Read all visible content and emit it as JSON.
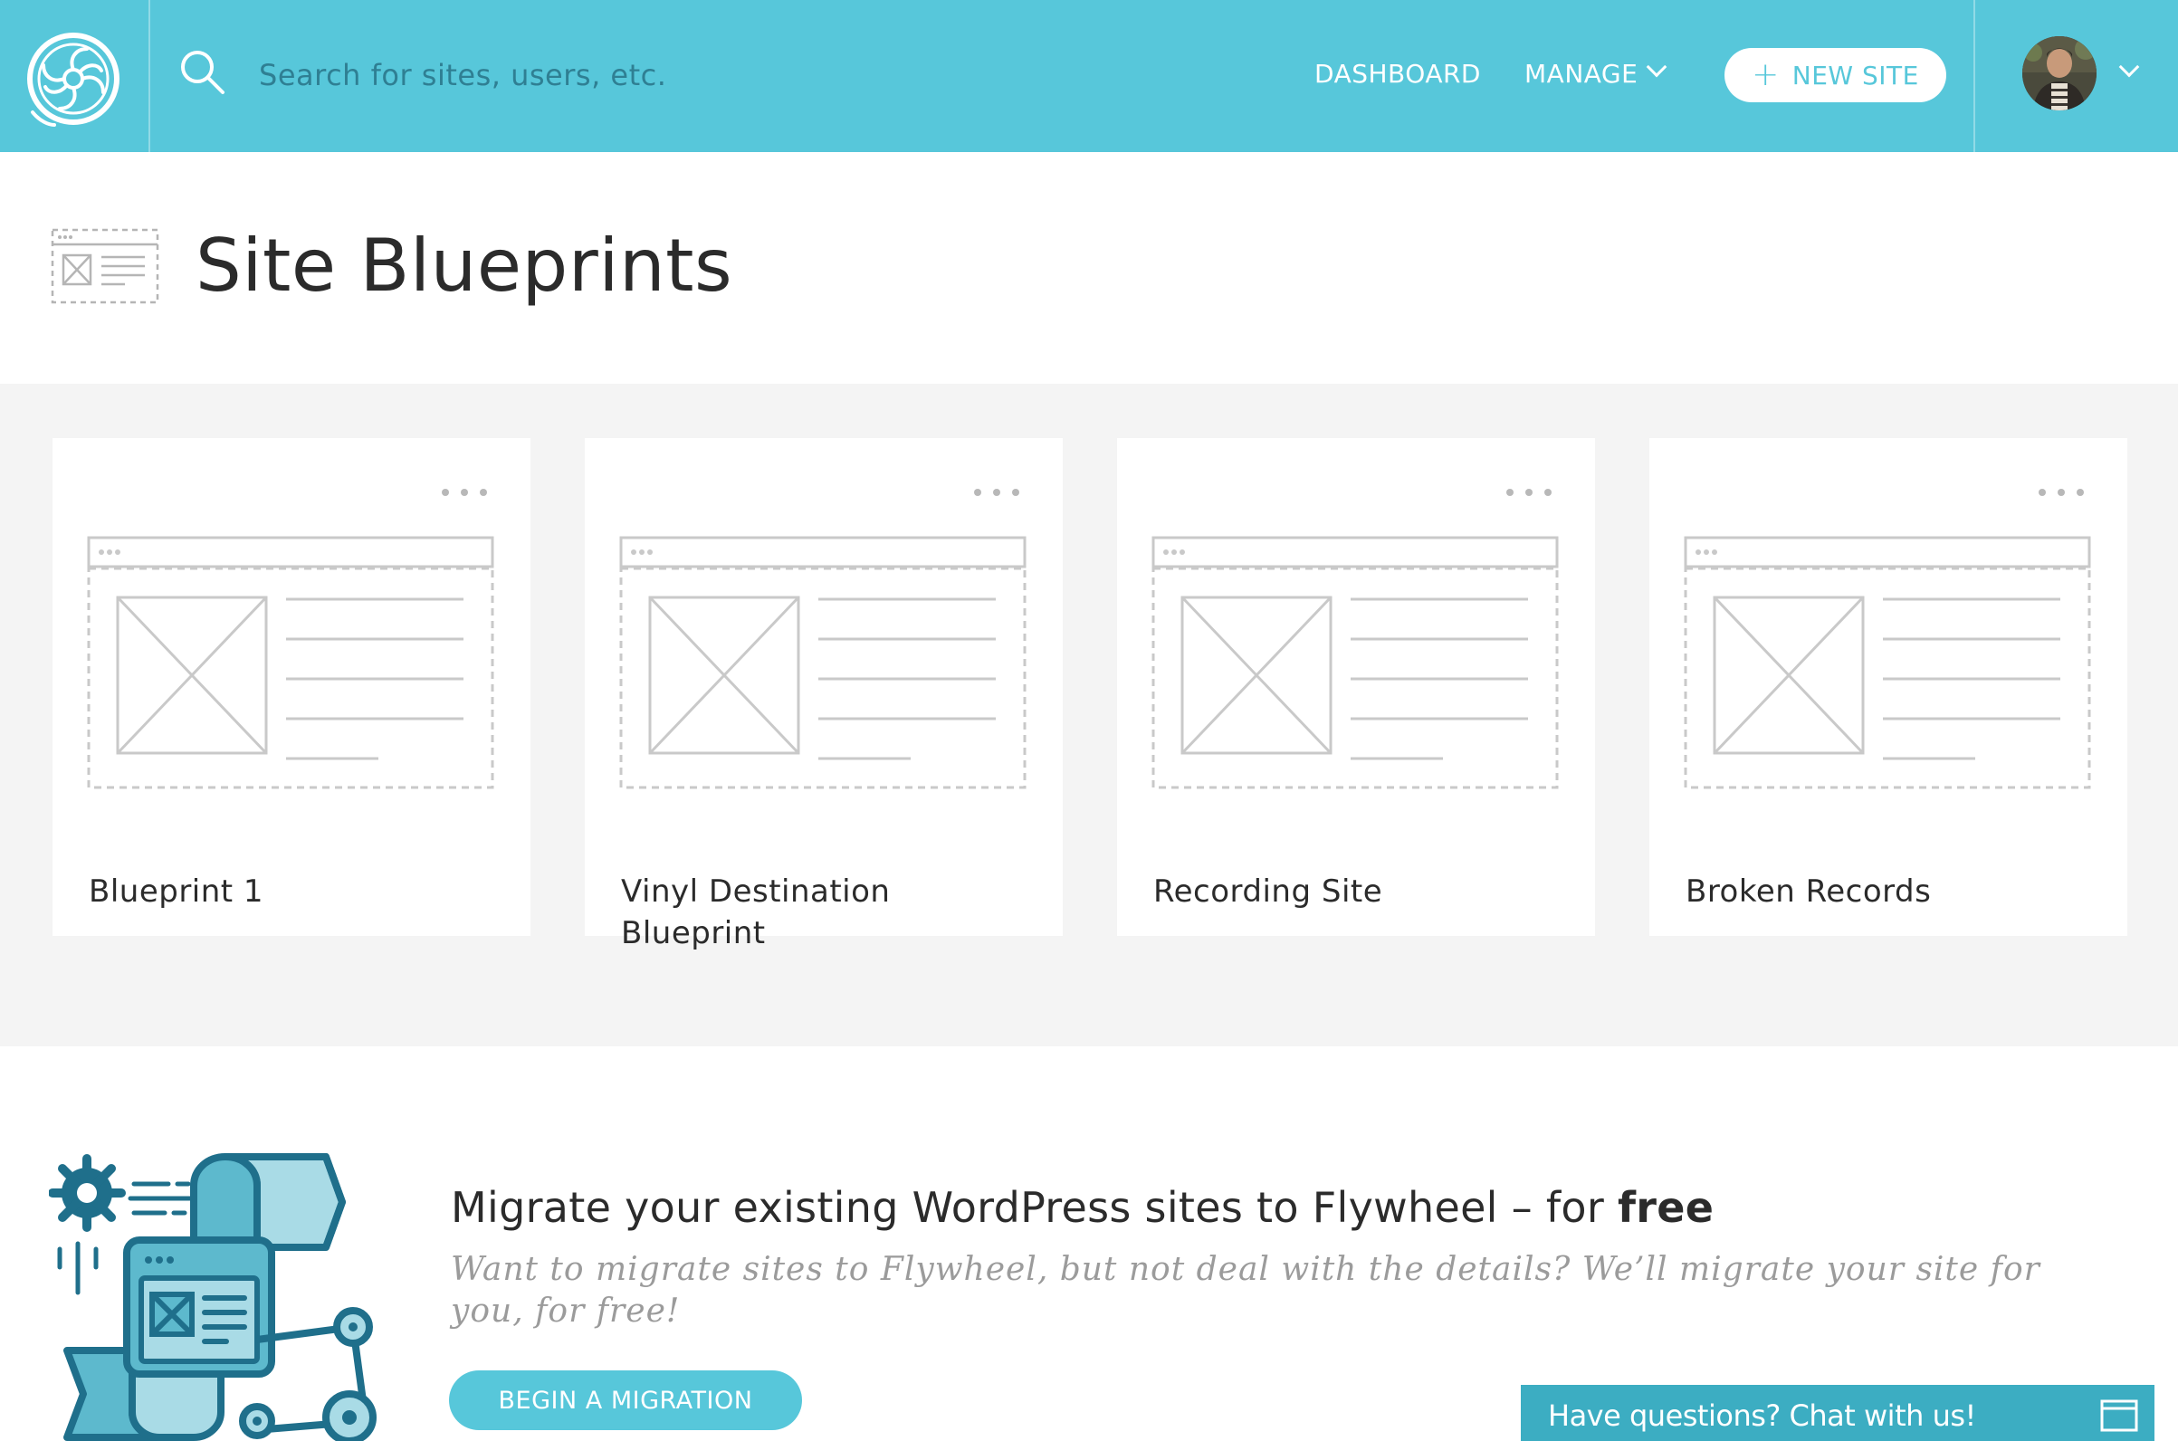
{
  "header": {
    "logo": "flywheel-logo-icon",
    "search": {
      "icon": "search-icon",
      "placeholder": "Search for sites, users, etc.",
      "value": ""
    },
    "nav": {
      "dashboard_label": "DASHBOARD",
      "manage_label": "MANAGE"
    },
    "new_site_label": "NEW SITE",
    "account": {
      "avatar": "avatar",
      "menu_icon": "chevron-down-icon"
    },
    "color": "#57c7da"
  },
  "page": {
    "title": "Site Blueprints",
    "title_icon": "blueprint-icon"
  },
  "blueprints": [
    {
      "name": "Blueprint 1"
    },
    {
      "name": "Vinyl Destination Blueprint"
    },
    {
      "name": "Recording Site"
    },
    {
      "name": "Broken Records"
    }
  ],
  "migration": {
    "title_prefix": "Migrate your existing WordPress sites to Flywheel – for ",
    "title_emphasis": "free",
    "description": "Want to migrate sites to Flywheel, but not deal with the details? We’ll migrate your site for you, for free!",
    "button_label": "BEGIN A MIGRATION",
    "illustration": "migration-illustration"
  },
  "chat": {
    "label": "Have questions? Chat with us!",
    "icon": "chat-window-icon"
  }
}
